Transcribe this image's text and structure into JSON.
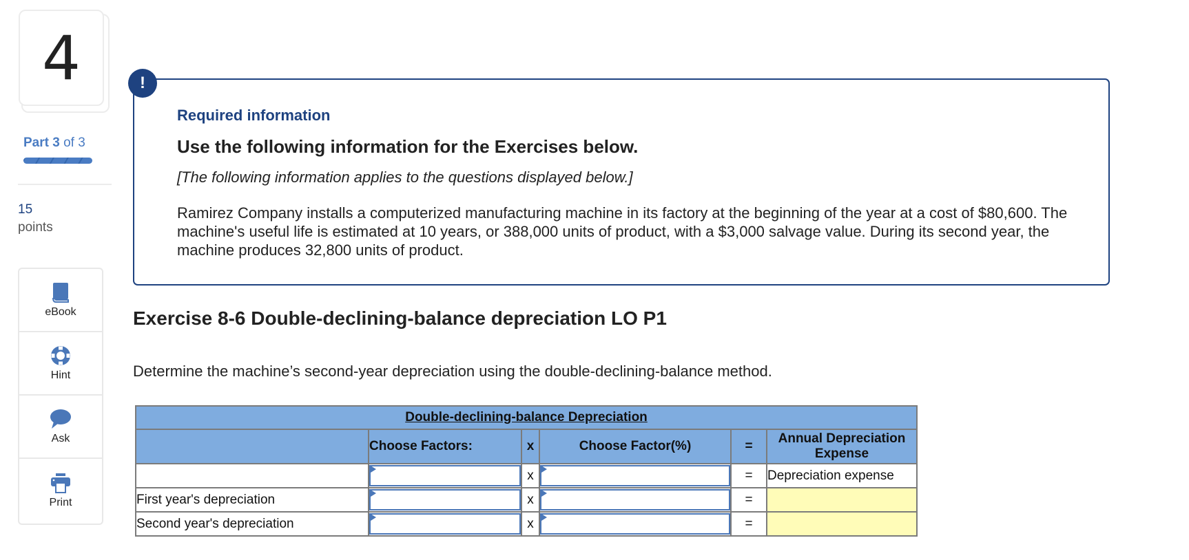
{
  "sidebar": {
    "question_number": "4",
    "part_label": "Part",
    "part_current": "3",
    "part_of": "of 3",
    "part_progress": 1.0,
    "points_value": "15",
    "points_label": "points",
    "tools": [
      {
        "label": "eBook",
        "icon": "book-icon"
      },
      {
        "label": "Hint",
        "icon": "lifebuoy-icon"
      },
      {
        "label": "Ask",
        "icon": "speech-bubble-icon"
      },
      {
        "label": "Print",
        "icon": "printer-icon"
      }
    ]
  },
  "info_box": {
    "badge": "!",
    "required_title": "Required information",
    "heading": "Use the following information for the Exercises below.",
    "applies_note": "[The following information applies to the questions displayed below.]",
    "paragraph": "Ramirez Company installs a computerized manufacturing machine in its factory at the beginning of the year at a cost of $80,600. The machine's useful life is estimated at 10 years, or 388,000 units of product, with a $3,000 salvage value. During its second year, the machine produces 32,800 units of product."
  },
  "exercise": {
    "title": "Exercise 8-6 Double-declining-balance depreciation LO P1",
    "instruction": "Determine the machine’s second-year depreciation using the double-declining-balance method."
  },
  "table": {
    "caption": "Double-declining-balance Depreciation",
    "headers": {
      "label": "",
      "factor1": "Choose Factors:",
      "times": "x",
      "factor2": "Choose Factor(%)",
      "equals": "=",
      "result": "Annual Depreciation Expense"
    },
    "rows": [
      {
        "label": "",
        "factor1": "",
        "times": "x",
        "factor2": "",
        "equals": "=",
        "result": "Depreciation expense",
        "result_input": false
      },
      {
        "label": "First year's depreciation",
        "factor1": "",
        "times": "x",
        "factor2": "",
        "equals": "=",
        "result": "",
        "result_input": true
      },
      {
        "label": "Second year's depreciation",
        "factor1": "",
        "times": "x",
        "factor2": "",
        "equals": "=",
        "result": "",
        "result_input": true
      }
    ]
  },
  "colors": {
    "brand_dark": "#1e4280",
    "brand": "#4a7cc3",
    "table_header": "#7facdf",
    "answer_cell": "#fffcb8"
  }
}
